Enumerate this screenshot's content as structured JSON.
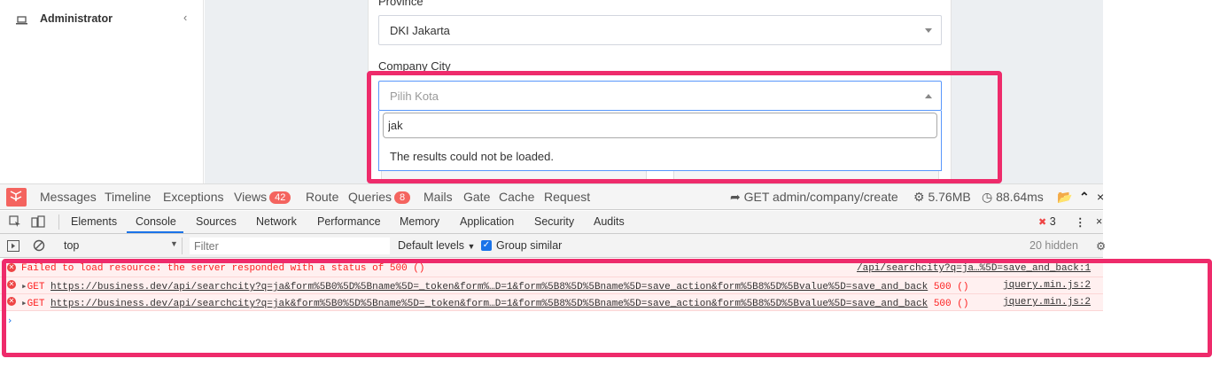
{
  "sidebar": {
    "admin_label": "Administrator",
    "icon": "laptop-icon"
  },
  "form": {
    "province_label": "Province",
    "province_value": "DKI Jakarta",
    "city_label": "Company City",
    "city_placeholder": "Pilih Kota",
    "search_value": "jak",
    "dropdown_message": "The results could not be loaded."
  },
  "debugbar": {
    "items": [
      "Messages",
      "Timeline",
      "Exceptions",
      "Views",
      "Route",
      "Queries",
      "Mails",
      "Gate",
      "Cache",
      "Request"
    ],
    "views_count": "42",
    "queries_count": "8",
    "route": "GET admin/company/create",
    "memory": "5.76MB",
    "time": "88.64ms"
  },
  "devtools": {
    "tabs": [
      "Elements",
      "Console",
      "Sources",
      "Network",
      "Performance",
      "Memory",
      "Application",
      "Security",
      "Audits"
    ],
    "active_tab": "Console",
    "error_count": "3",
    "context": "top",
    "filter_placeholder": "Filter",
    "levels": "Default levels",
    "group_similar": "Group similar",
    "hidden": "20 hidden",
    "logs": [
      {
        "text": "Failed to load resource: the server responded with a status of 500 ()",
        "source": "/api/searchcity?q=ja…%5D=save_and_back:1"
      },
      {
        "method": "GET",
        "url": "https://business.dev/api/searchcity?q=ja&form%5B0%5D%5Bname%5D=_token&form%…D=1&form%5B8%5D%5Bname%5D=save_action&form%5B8%5D%5Bvalue%5D=save_and_back",
        "status": "500 ()",
        "source": "jquery.min.js:2"
      },
      {
        "method": "GET",
        "url": "https://business.dev/api/searchcity?q=jak&form%5B0%5D%5Bname%5D=_token&form…D=1&form%5B8%5D%5Bname%5D=save_action&form%5B8%5D%5Bvalue%5D=save_and_back",
        "status": "500 ()",
        "source": "jquery.min.js:2"
      }
    ],
    "prompt": "›"
  },
  "colors": {
    "highlight": "#ee2b6b",
    "error": "#fd1f1f",
    "accent": "#1a73e8",
    "laravel": "#f4645f"
  }
}
